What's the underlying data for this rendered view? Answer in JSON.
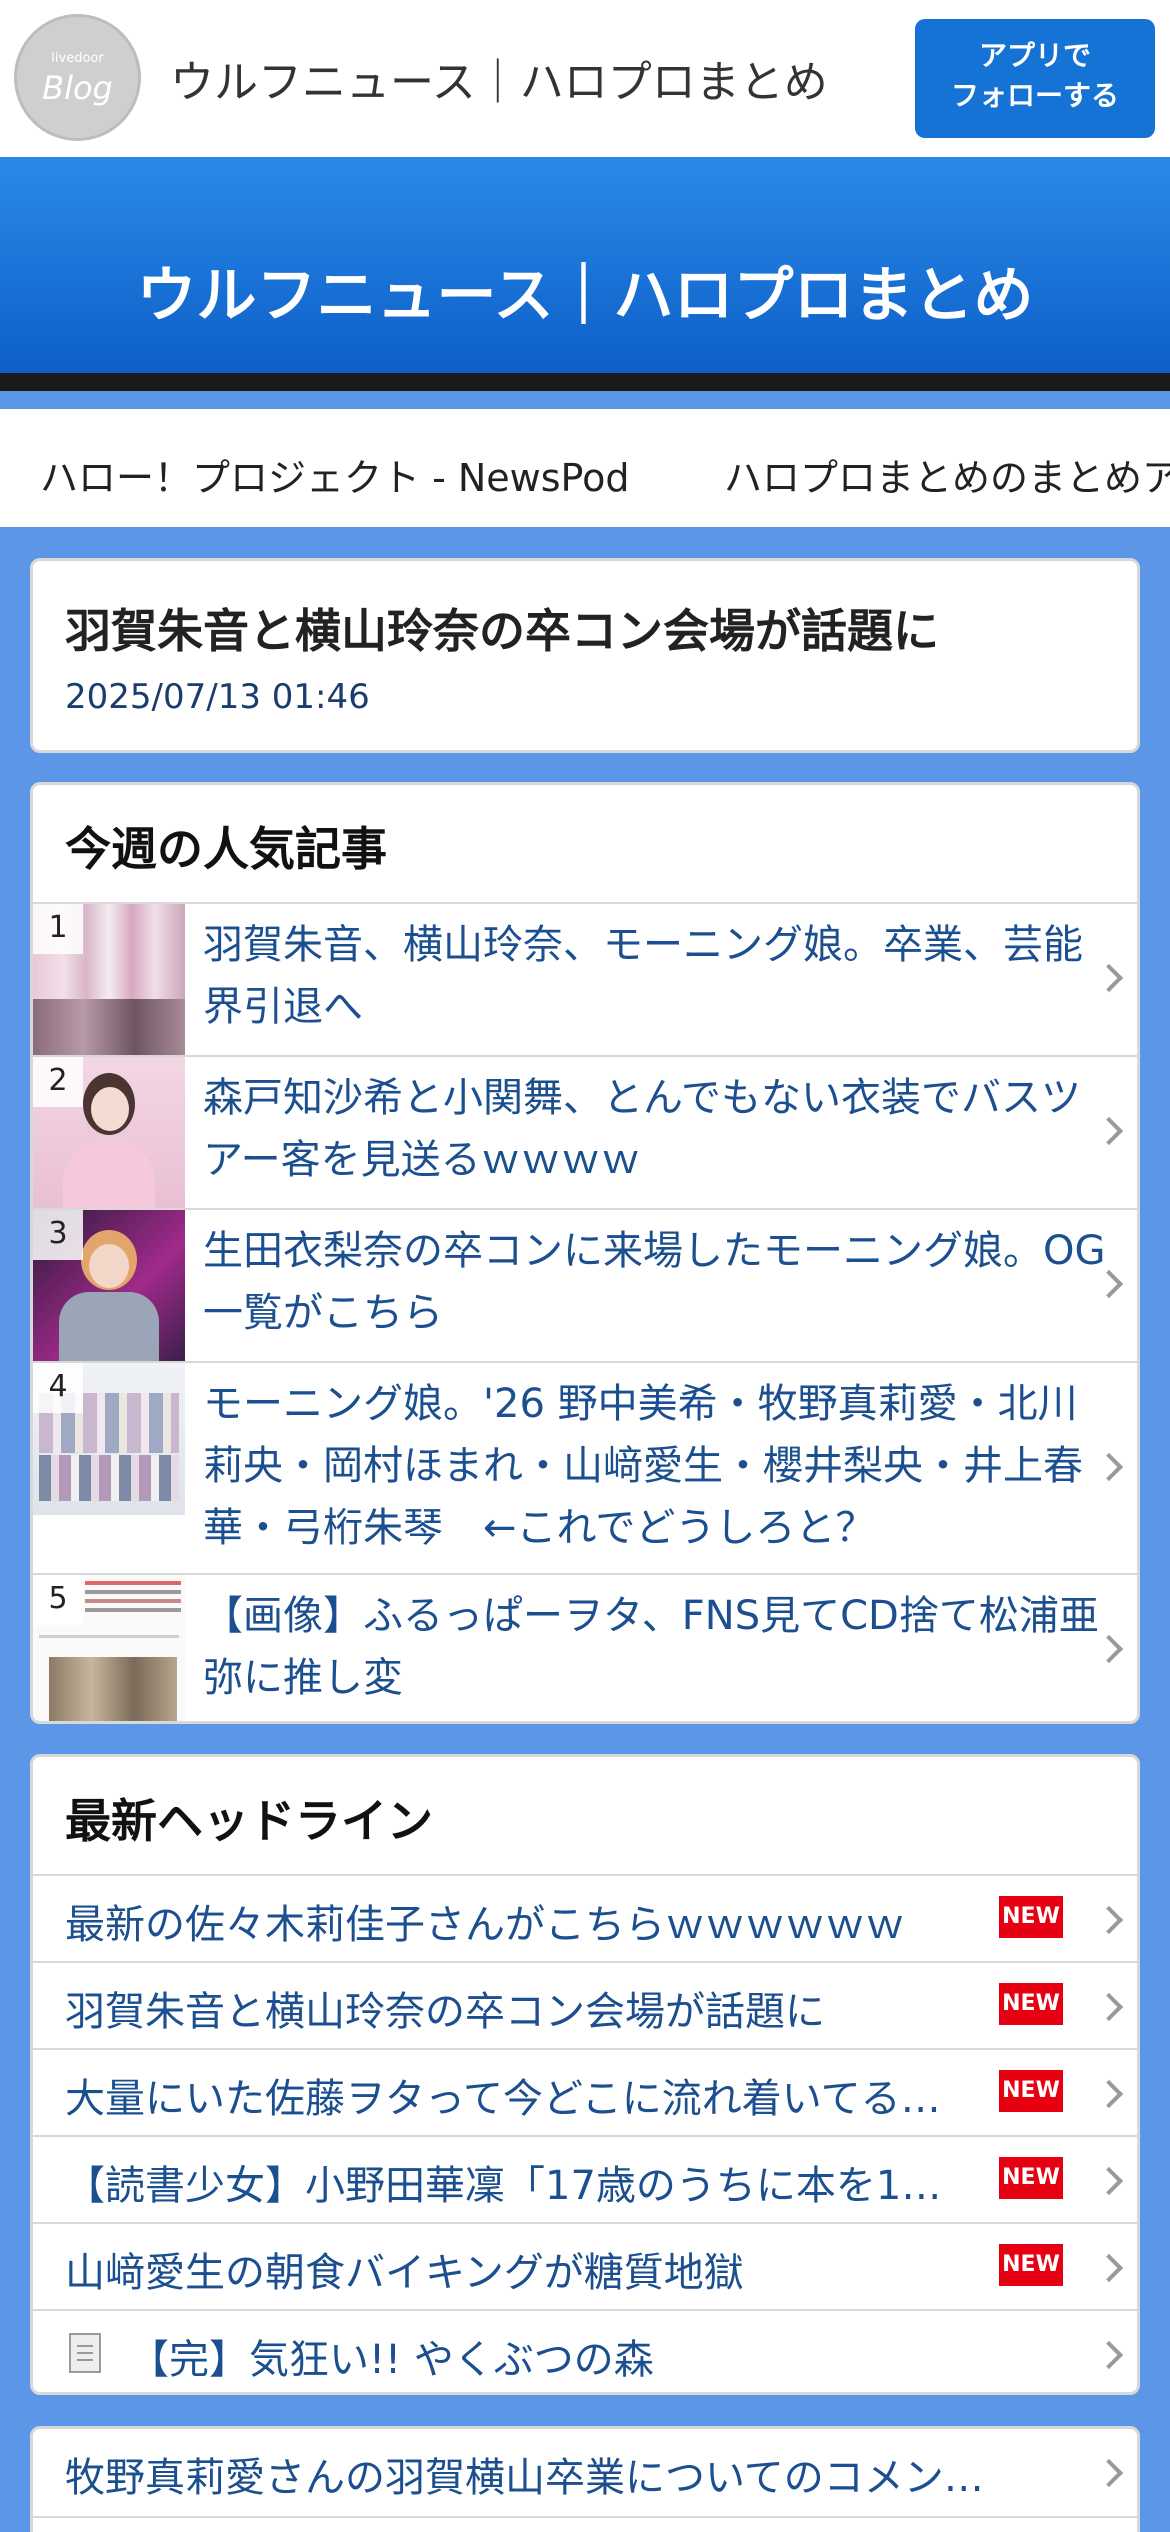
{
  "header": {
    "logo_small": "livedoor",
    "logo_big": "Blog",
    "site_name": "ウルフニュース｜ハロプロまとめ",
    "follow_button_line1": "アプリで",
    "follow_button_line2": "フォローする"
  },
  "banner": {
    "title": "ウルフニュース｜ハロプロまとめ"
  },
  "nav": {
    "items": [
      "ハロー！プロジェクト - NewsPod",
      "ハロプロまとめのまとめア"
    ]
  },
  "article": {
    "title": "羽賀朱音と横山玲奈の卒コン会場が話題に",
    "date": "2025/07/13 01:46"
  },
  "popular": {
    "heading": "今週の人気記事",
    "items": [
      {
        "rank": "1",
        "title": "羽賀朱音、横山玲奈、モーニング娘。卒業、芸能界引退へ"
      },
      {
        "rank": "2",
        "title": "森戸知沙希と小関舞、とんでもない衣装でバスツアー客を見送るｗｗｗｗ"
      },
      {
        "rank": "3",
        "title": "生田衣梨奈の卒コンに来場したモーニング娘。OG一覧がこちら"
      },
      {
        "rank": "4",
        "title": "モーニング娘。'26 野中美希・牧野真莉愛・北川莉央・岡村ほまれ・山﨑愛生・櫻井梨央・井上春華・弓桁朱琴　←これでどうしろと？"
      },
      {
        "rank": "5",
        "title": "【画像】ふるっぱーヲタ、FNS見てCD捨て松浦亜弥に推し変"
      }
    ]
  },
  "headlines": {
    "heading": "最新ヘッドライン",
    "new_label": "NEW",
    "items": [
      {
        "title": "最新の佐々木莉佳子さんがこちらｗｗｗｗｗｗ",
        "new": true
      },
      {
        "title": "羽賀朱音と横山玲奈の卒コン会場が話題に",
        "new": true
      },
      {
        "title": "大量にいた佐藤ヲタって今どこに流れ着いてる…",
        "new": true
      },
      {
        "title": "【読書少女】小野田華凜「17歳のうちに本を1…",
        "new": true
      },
      {
        "title": "山﨑愛生の朝食バイキングが糖質地獄",
        "new": true
      },
      {
        "title": "【完】気狂い!! やくぶつの森",
        "new": false
      }
    ]
  },
  "related": {
    "items": [
      "牧野真莉愛さんの羽賀横山卒業についてのコメン…"
    ]
  }
}
